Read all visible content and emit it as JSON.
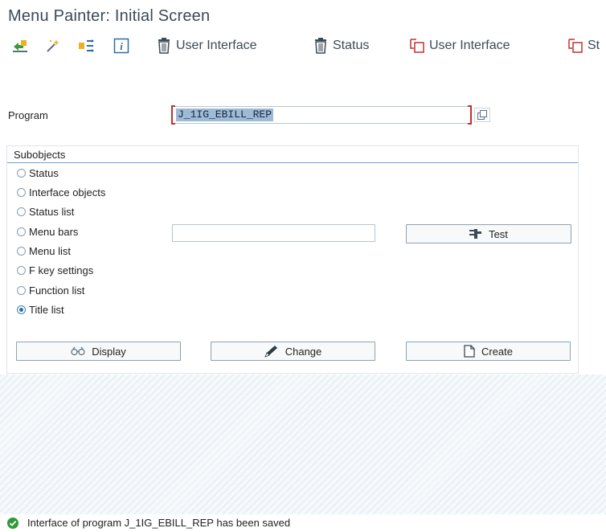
{
  "window": {
    "title": "Menu Painter: Initial Screen"
  },
  "toolbar": {
    "icons": [
      "other-object-icon",
      "wizard-icon",
      "where-used-icon",
      "information-icon"
    ],
    "delete_ui_label": "User Interface",
    "delete_status_label": "Status",
    "copy_ui_label": "User Interface",
    "copy_status_label": "St"
  },
  "program": {
    "label": "Program",
    "value": "J_1IG_EBILL_REP"
  },
  "subobjects": {
    "title": "Subobjects",
    "selected": "Title list",
    "options": [
      {
        "label": "Status",
        "selected": false
      },
      {
        "label": "Interface objects",
        "selected": false
      },
      {
        "label": "Status list",
        "selected": false
      },
      {
        "label": "Menu bars",
        "selected": false
      },
      {
        "label": "Menu list",
        "selected": false
      },
      {
        "label": "F key settings",
        "selected": false
      },
      {
        "label": "Function list",
        "selected": false
      },
      {
        "label": "Title list",
        "selected": true
      }
    ],
    "status_value": ""
  },
  "buttons": {
    "test": "Test",
    "display": "Display",
    "change": "Change",
    "create": "Create"
  },
  "statusbar": {
    "type": "success",
    "message": "Interface of program J_1IG_EBILL_REP has been saved"
  },
  "colors": {
    "accent": "#6fa3cc",
    "selection": "#9dbad6",
    "success": "#2f9a3a",
    "required_marker": "#c2302f"
  }
}
